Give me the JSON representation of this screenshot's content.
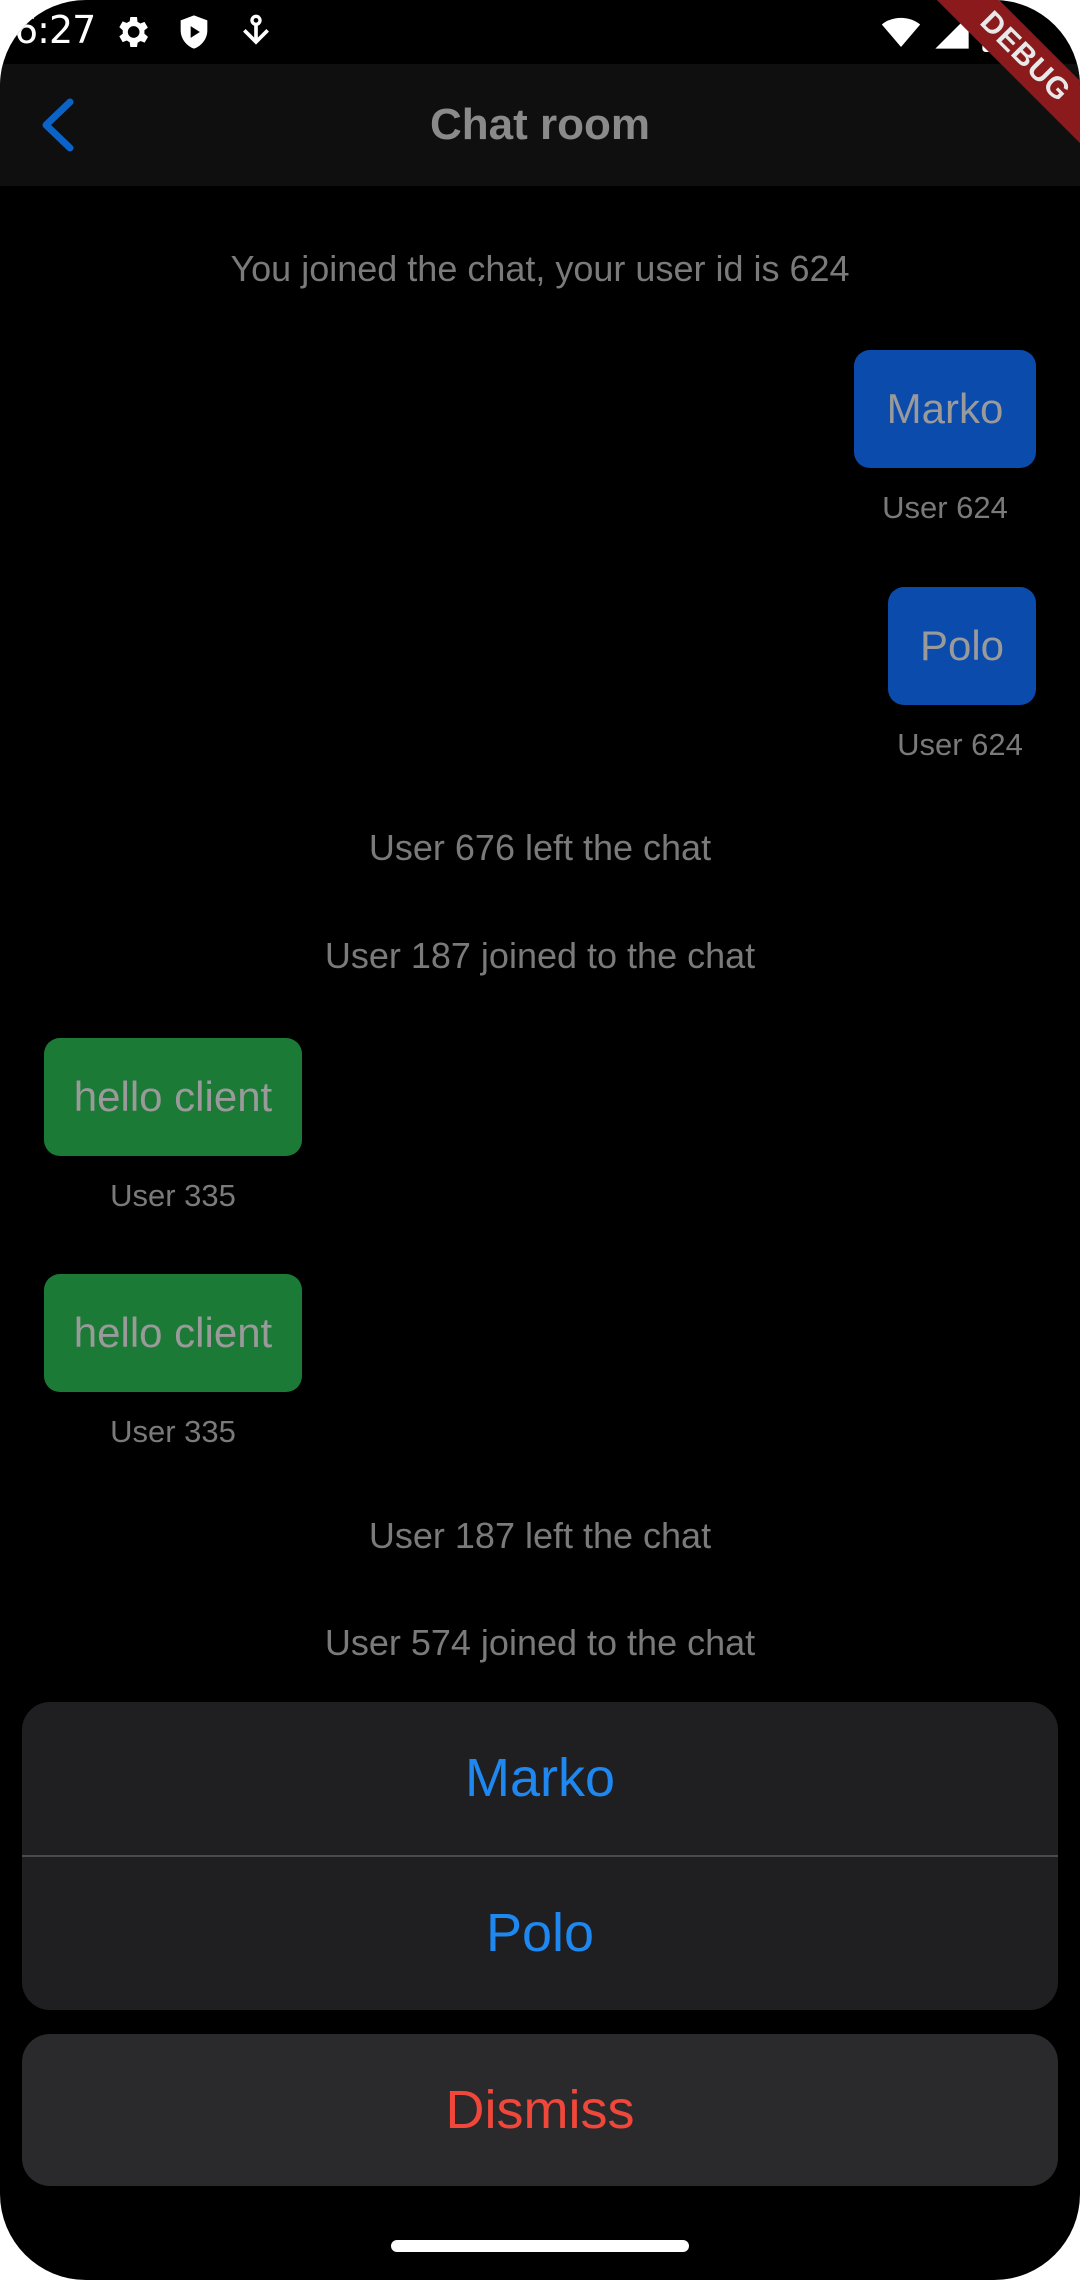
{
  "status_bar": {
    "time": "6:27",
    "icons_left": [
      "settings-icon",
      "shield-icon",
      "download-icon"
    ],
    "icons_right": [
      "wifi-icon",
      "signal-icon",
      "battery-icon"
    ]
  },
  "debug_banner": "DEBUG",
  "app_bar": {
    "title": "Chat room",
    "back_icon": "back-arrow-icon"
  },
  "messages": [
    {
      "kind": "system",
      "text": "You joined the chat, your user id is 624"
    },
    {
      "kind": "bubble",
      "side": "own",
      "text": "Marko",
      "sender": "User 624"
    },
    {
      "kind": "bubble",
      "side": "own",
      "text": "Polo",
      "sender": "User 624"
    },
    {
      "kind": "system",
      "text": "User 676 left the chat"
    },
    {
      "kind": "system",
      "text": "User 187 joined to the chat"
    },
    {
      "kind": "bubble",
      "side": "other",
      "text": "hello client",
      "sender": "User 335"
    },
    {
      "kind": "bubble",
      "side": "other",
      "text": "hello client",
      "sender": "User 335"
    },
    {
      "kind": "system",
      "text": "User 187 left the chat"
    },
    {
      "kind": "system",
      "text": "User 574 joined to the chat"
    }
  ],
  "action_sheet": {
    "actions": [
      "Marko",
      "Polo"
    ],
    "cancel": "Dismiss"
  },
  "colors": {
    "own_bubble": "#0b4bab",
    "other_bubble": "#1b7a35",
    "action": "#1e88f0",
    "destructive": "#f0473a",
    "background": "#000000"
  }
}
